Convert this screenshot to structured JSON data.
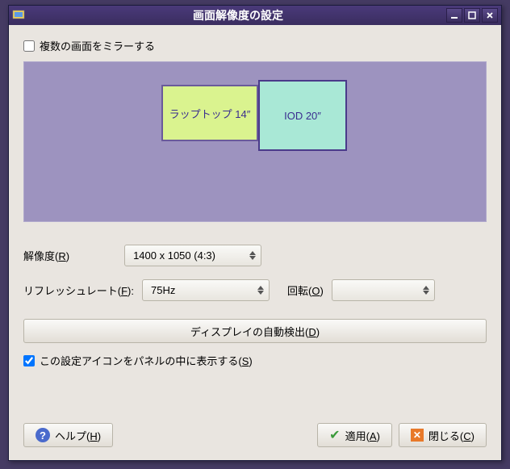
{
  "titlebar": {
    "title": "画面解像度の設定"
  },
  "mirror": {
    "label": "複数の画面をミラーする",
    "checked": false
  },
  "monitors": [
    {
      "label": "ラップトップ 14″"
    },
    {
      "label": "IOD 20″"
    }
  ],
  "resolution": {
    "label": "解像度(",
    "accel": "R",
    "label_end": ")",
    "value": "1400 x 1050 (4:3)"
  },
  "refresh": {
    "label": "リフレッシュレート(",
    "accel": "F",
    "label_end": "):",
    "value": "75Hz"
  },
  "rotation": {
    "label": "回転(",
    "accel": "O",
    "label_end": ")",
    "value": ""
  },
  "detect": {
    "label": "ディスプレイの自動検出(",
    "accel": "D",
    "label_end": ")"
  },
  "panel_icon": {
    "label": "この設定アイコンをパネルの中に表示する(",
    "accel": "S",
    "label_end": ")",
    "checked": true
  },
  "buttons": {
    "help": {
      "label": "ヘルプ(",
      "accel": "H",
      "label_end": ")"
    },
    "apply": {
      "label": "適用(",
      "accel": "A",
      "label_end": ")"
    },
    "close": {
      "label": "閉じる(",
      "accel": "C",
      "label_end": ")"
    }
  }
}
